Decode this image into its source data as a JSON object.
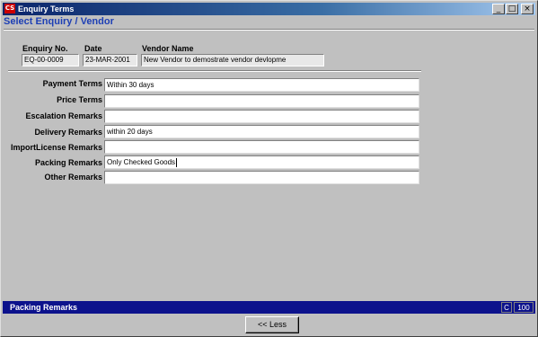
{
  "window": {
    "app_icon": "CS",
    "title": "Enquiry Terms",
    "controls": {
      "minimize": "_",
      "maximize": "□",
      "close": "×"
    }
  },
  "header": {
    "title": "Select Enquiry / Vendor"
  },
  "enquiry": {
    "enquiry_no_label": "Enquiry No.",
    "enquiry_no": "EQ-00-0009",
    "date_label": "Date",
    "date": "23-MAR-2001",
    "vendor_name_label": "Vendor Name",
    "vendor_name": "New Vendor to demostrate vendor devlopme"
  },
  "terms": [
    {
      "label": "Payment Terms",
      "value": "Within 30 days"
    },
    {
      "label": "Price Terms",
      "value": ""
    },
    {
      "label": "Escalation Remarks",
      "value": ""
    },
    {
      "label": "Delivery Remarks",
      "value": "within 20 days"
    },
    {
      "label": "ImportLicense Remarks",
      "value": ""
    },
    {
      "label": "Packing Remarks",
      "value": "Only Checked Goods"
    },
    {
      "label": "Other Remarks",
      "value": ""
    }
  ],
  "status": {
    "text": "Packing Remarks",
    "mode": "C",
    "value": "100"
  },
  "footer": {
    "less_button": "<< Less"
  }
}
